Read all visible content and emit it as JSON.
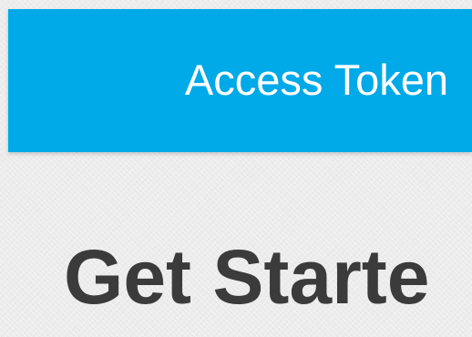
{
  "header": {
    "link_label": "Access Token",
    "background_color": "#00a9e8",
    "text_color": "#ffffff"
  },
  "main": {
    "heading": "Get Starte",
    "heading_color": "#3b3b3b",
    "page_background": "#ececec"
  }
}
